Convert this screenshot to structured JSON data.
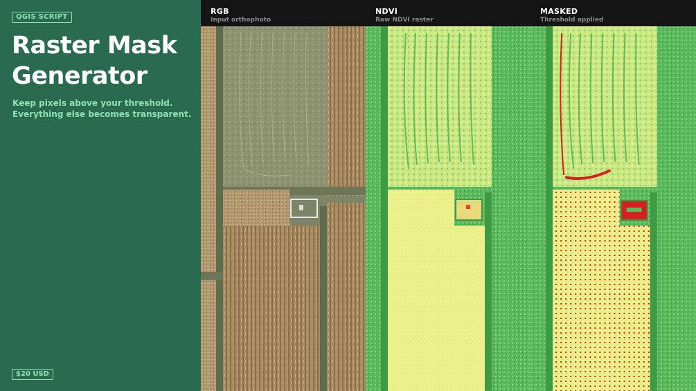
{
  "product": {
    "tag": "QGIS SCRIPT",
    "title": "Raster Mask Generator",
    "subtitle": "Keep pixels above your threshold. Everything else becomes transparent.",
    "price": "$20 USD"
  },
  "panels": [
    {
      "title": "RGB",
      "caption": "Input orthophoto",
      "image": "aerial-field-rgb"
    },
    {
      "title": "NDVI",
      "caption": "Raw NDVI raster",
      "image": "aerial-field-ndvi"
    },
    {
      "title": "MASKED",
      "caption": "Threshold applied",
      "image": "aerial-field-masked"
    }
  ],
  "colors": {
    "sidebar_bg": "#2a6b4f",
    "accent": "#8fe0b4",
    "header_bg": "#141414",
    "ndvi_high": "#4caf50",
    "ndvi_low": "#f0f08a",
    "mask_red": "#d42020"
  }
}
